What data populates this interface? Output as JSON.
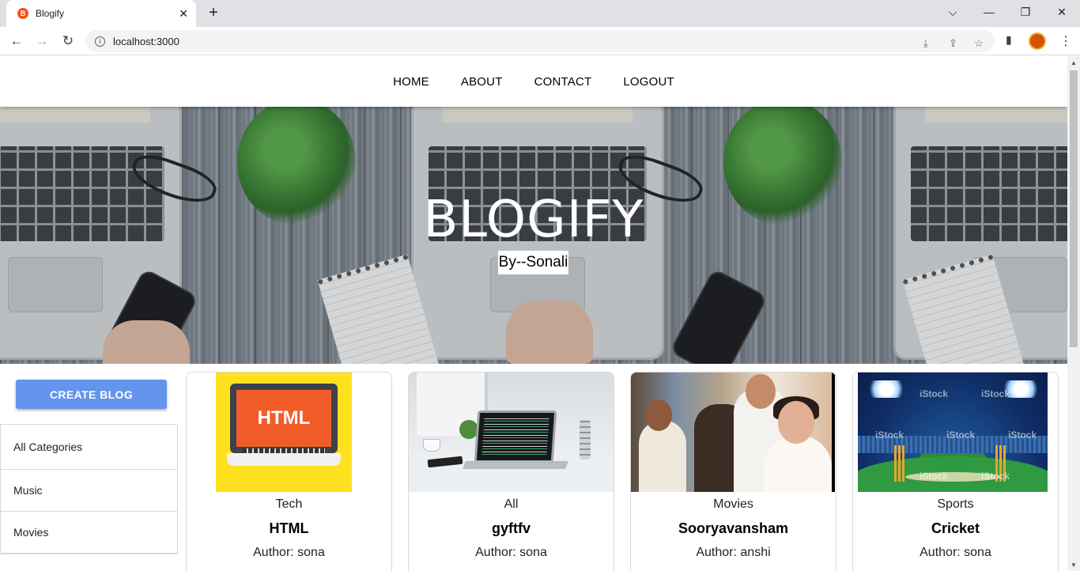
{
  "browser": {
    "tab_title": "Blogify",
    "favicon_letter": "B",
    "close_glyph": "✕",
    "new_tab_glyph": "+",
    "url": "localhost:3000",
    "window_controls": {
      "dropdown": "⌵",
      "minimize": "—",
      "restore": "❐",
      "close": "✕"
    },
    "nav": {
      "back": "←",
      "forward": "→",
      "reload": "↻"
    },
    "icons": {
      "install": "⤓",
      "share": "⇪",
      "bookmark": "☆",
      "side_panel": "▮",
      "menu": "⋮",
      "info": "i"
    }
  },
  "nav": {
    "items": [
      {
        "label": "HOME"
      },
      {
        "label": "ABOUT"
      },
      {
        "label": "CONTACT"
      },
      {
        "label": "LOGOUT"
      }
    ]
  },
  "hero": {
    "title": "BLOGIFY",
    "subtitle": "By--Sonali"
  },
  "sidebar": {
    "create_label": "CREATE BLOG",
    "categories": [
      {
        "label": "All Categories"
      },
      {
        "label": "Music"
      },
      {
        "label": "Movies"
      }
    ]
  },
  "posts": [
    {
      "category": "Tech",
      "title": "HTML",
      "author": "Author: sona",
      "image_text": "HTML"
    },
    {
      "category": "All",
      "title": "gyftfv",
      "author": "Author: sona"
    },
    {
      "category": "Movies",
      "title": "Sooryavansham",
      "author": "Author: anshi"
    },
    {
      "category": "Sports",
      "title": "Cricket",
      "author": "Author: sona",
      "watermark": "iStock"
    }
  ],
  "colors": {
    "create_button": "#6495ed",
    "tabstrip": "#dfe1e5",
    "favicon": "#f4511e"
  }
}
